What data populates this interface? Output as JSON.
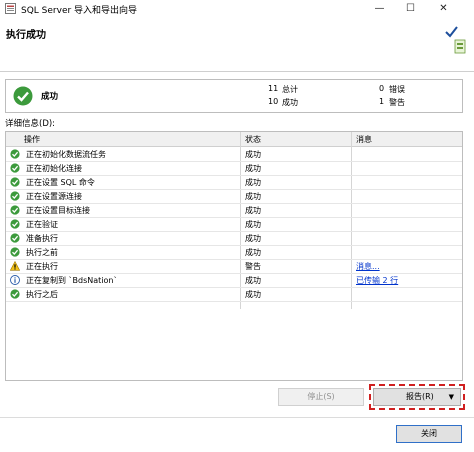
{
  "window": {
    "title": "SQL Server 导入和导出向导",
    "minimize": "—",
    "maximize": "☐",
    "close": "✕"
  },
  "header": {
    "title": "执行成功"
  },
  "summary": {
    "status": "成功",
    "stats": [
      {
        "count": "11",
        "label": "总计"
      },
      {
        "count": "10",
        "label": "成功"
      },
      {
        "count": "0",
        "label": "错误"
      },
      {
        "count": "1",
        "label": "警告"
      }
    ]
  },
  "details": {
    "label": "详细信息(D):",
    "columns": [
      "操作",
      "状态",
      "消息"
    ],
    "rows": [
      {
        "icon": "success",
        "action": "正在初始化数据流任务",
        "status": "成功",
        "message": ""
      },
      {
        "icon": "success",
        "action": "正在初始化连接",
        "status": "成功",
        "message": ""
      },
      {
        "icon": "success",
        "action": "正在设置 SQL 命令",
        "status": "成功",
        "message": ""
      },
      {
        "icon": "success",
        "action": "正在设置源连接",
        "status": "成功",
        "message": ""
      },
      {
        "icon": "success",
        "action": "正在设置目标连接",
        "status": "成功",
        "message": ""
      },
      {
        "icon": "success",
        "action": "正在验证",
        "status": "成功",
        "message": ""
      },
      {
        "icon": "success",
        "action": "准备执行",
        "status": "成功",
        "message": ""
      },
      {
        "icon": "success",
        "action": "执行之前",
        "status": "成功",
        "message": ""
      },
      {
        "icon": "warning",
        "action": "正在执行",
        "status": "警告",
        "message": "消息..."
      },
      {
        "icon": "info",
        "action": "正在复制到 `BdsNation`",
        "status": "成功",
        "message": "已传输 2 行"
      },
      {
        "icon": "success",
        "action": "执行之后",
        "status": "成功",
        "message": ""
      }
    ]
  },
  "buttons": {
    "stop": "停止(S)",
    "report": "报告(R)",
    "report_arrow": "▼",
    "close": "关闭"
  }
}
